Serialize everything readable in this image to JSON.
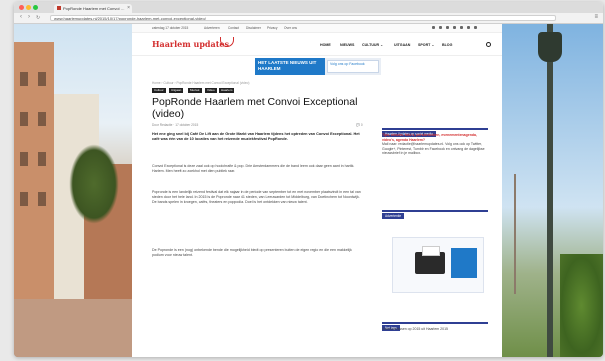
{
  "browser": {
    "tab_title": "PopRonde Haarlem met Convoi …",
    "url": "www.haarlemupdates.nl/2015/10/17/popronde-haarlem-met-convoi-exceptional-video/",
    "colors": {
      "close": "#ff5f57",
      "minimize": "#febc2e",
      "maximize": "#28c840"
    }
  },
  "site": {
    "top_links": [
      "zaterdag 17 oktober 2015",
      "Adverteren",
      "Contact",
      "Disclaimer",
      "Privacy",
      "Over ons"
    ],
    "logo": "Haarlem updates",
    "menu": [
      "HOME",
      "NIEUWS",
      "CULTUUR",
      "UITGAAN",
      "SPORT",
      "BLOG"
    ],
    "menu_dropdown_marks": [
      "",
      "",
      "⌄",
      "",
      "⌄",
      ""
    ],
    "ad": {
      "headline": "HET LAATSTE NIEUWS UIT HAARLEM",
      "cta": "Volg ons op Facebook"
    },
    "breadcrumb": "Home › Cultuur › PopRonde Haarlem met Convoi Exceptional (video)",
    "categories": [
      "Cultuur",
      "Uitgaan",
      "Muziek",
      "Video",
      "Haarlem"
    ],
    "article": {
      "title": "PopRonde Haarlem met Convoi Exceptional (video)",
      "meta": "Door Redactie · 17 oktober 2015",
      "comments": "0",
      "lead": "Het ene ging snel bij Café De Lift aan de Grote Markt van Haarlem tijdens het optreden van Convoi Exceptional. Het café was één van de 10 locaties van het reizende muziekfestival PopRonde.",
      "paragraphs": [
        "Convoi Exceptional is deze zaal ook op hoolchrafie & pop. Drie Amsterdammers die de band leem ook daar geen aant in hartik. Harlem. Men heeft zo zoekhol met dien publiek raar.",
        "Popronde is een landelijk reizend festival dat elk najaar in de periode van september tot en met november plaatsvindt in een tal van steden door het hele land. In 2015 is de Popronde naar 41 steden, van Leeuwarden tot Middelburg, van Doetinchem tot Noordwijk. De bands spelen in kroegen, cafés, theaters en poppodia. Doel is het ontdekken van nieuw talent.",
        "De Popronde is een (nog) onbekende bende die mogelijkheid biedt op presenteren buiten de eigen regio en die een makkelijk podium voor nieuw talent."
      ]
    },
    "sidebar": {
      "follow_head": "Haarlem Updates op social media",
      "follow_text_red": "Tips, nieuws, foto's, persberichten, evenementenagenda, video's, agenda Haarlem?",
      "follow_text": "Mail naar: redactie@haarlemupdates.nl. Volg ons ook op Twitter, Google+, Pinterest, Tumblr en Facebook en ontvang de dagelijkse nieuwsbrief in je mailbox.",
      "ad_head": "Advertentie",
      "bottom_head": "Net tags",
      "bottom_text": "Gebeurtenissen op 2015 uit Haarlem 2015"
    }
  }
}
